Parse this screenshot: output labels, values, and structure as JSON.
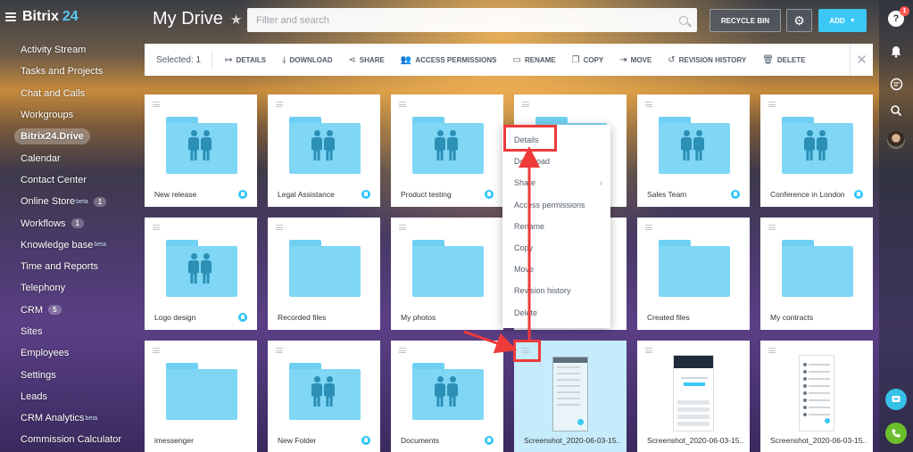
{
  "brand": {
    "name": "Bitrix",
    "number": "24"
  },
  "page": {
    "title": "My Drive"
  },
  "search": {
    "placeholder": "Filter and search"
  },
  "header": {
    "recycle_label": "RECYCLE BIN",
    "add_label": "ADD"
  },
  "rail": {
    "notification_count": "1",
    "help_label": "?"
  },
  "sidebar": {
    "items": [
      {
        "label": "Activity Stream"
      },
      {
        "label": "Tasks and Projects"
      },
      {
        "label": "Chat and Calls"
      },
      {
        "label": "Workgroups"
      },
      {
        "label": "Bitrix24.Drive",
        "active": true
      },
      {
        "label": "Calendar"
      },
      {
        "label": "Contact Center"
      },
      {
        "label": "Online Store",
        "sup": "beta",
        "count": "1"
      },
      {
        "label": "Workflows",
        "count": "1"
      },
      {
        "label": "Knowledge base",
        "sup": "beta"
      },
      {
        "label": "Time and Reports"
      },
      {
        "label": "Telephony"
      },
      {
        "label": "CRM",
        "count": "5"
      },
      {
        "label": "Sites"
      },
      {
        "label": "Employees"
      },
      {
        "label": "Settings"
      },
      {
        "label": "Leads"
      },
      {
        "label": "CRM Analytics",
        "sup": "beta"
      },
      {
        "label": "Commission Calculator"
      }
    ]
  },
  "toolbar": {
    "selected_label": "Selected: 1",
    "actions": [
      {
        "label": "DETAILS",
        "icon": "details-icon"
      },
      {
        "label": "DOWNLOAD",
        "icon": "download-icon"
      },
      {
        "label": "SHARE",
        "icon": "share-icon"
      },
      {
        "label": "ACCESS PERMISSIONS",
        "icon": "users-icon"
      },
      {
        "label": "RENAME",
        "icon": "rename-icon"
      },
      {
        "label": "COPY",
        "icon": "copy-icon"
      },
      {
        "label": "MOVE",
        "icon": "move-icon"
      },
      {
        "label": "REVISION HISTORY",
        "icon": "history-icon"
      },
      {
        "label": "DELETE",
        "icon": "trash-icon"
      }
    ]
  },
  "tiles": [
    {
      "name": "New release",
      "kind": "shared-folder",
      "shared": true
    },
    {
      "name": "Legal Assistance",
      "kind": "shared-folder",
      "shared": true
    },
    {
      "name": "Product testing",
      "kind": "shared-folder",
      "shared": true
    },
    {
      "name": "",
      "kind": "shared-folder",
      "shared": false
    },
    {
      "name": "Sales Team",
      "kind": "shared-folder",
      "shared": true
    },
    {
      "name": "Conference in London",
      "kind": "shared-folder",
      "shared": true
    },
    {
      "name": "Logo design",
      "kind": "shared-folder",
      "shared": true
    },
    {
      "name": "Recorded files",
      "kind": "folder",
      "shared": false
    },
    {
      "name": "My photos",
      "kind": "folder",
      "shared": false
    },
    {
      "name": "",
      "kind": "folder",
      "shared": false
    },
    {
      "name": "Created files",
      "kind": "folder",
      "shared": false
    },
    {
      "name": "My contracts",
      "kind": "folder",
      "shared": false
    },
    {
      "name": "imessenger",
      "kind": "folder",
      "shared": false
    },
    {
      "name": "New Folder",
      "kind": "shared-folder",
      "shared": true
    },
    {
      "name": "Documents",
      "kind": "shared-folder",
      "shared": true
    },
    {
      "name": "Screenshot_2020-06-03-15...",
      "kind": "screenshot-phone",
      "shared": false,
      "selected": true
    },
    {
      "name": "Screenshot_2020-06-03-15...",
      "kind": "screenshot-web",
      "shared": false
    },
    {
      "name": "Screenshot_2020-06-03-15...",
      "kind": "screenshot-list",
      "shared": false
    }
  ],
  "context_menu": {
    "items": [
      {
        "label": "Details"
      },
      {
        "label": "Download"
      },
      {
        "label": "Share",
        "submenu": true
      },
      {
        "label": "Access permissions"
      },
      {
        "label": "Rename"
      },
      {
        "label": "Copy"
      },
      {
        "label": "Move"
      },
      {
        "label": "Revision history"
      },
      {
        "label": "Delete"
      }
    ]
  },
  "colors": {
    "accent": "#3bc8f5",
    "folder": "#7fd6f5",
    "highlight": "#ef3b3a",
    "selected_tile": "#c6ebfb"
  }
}
